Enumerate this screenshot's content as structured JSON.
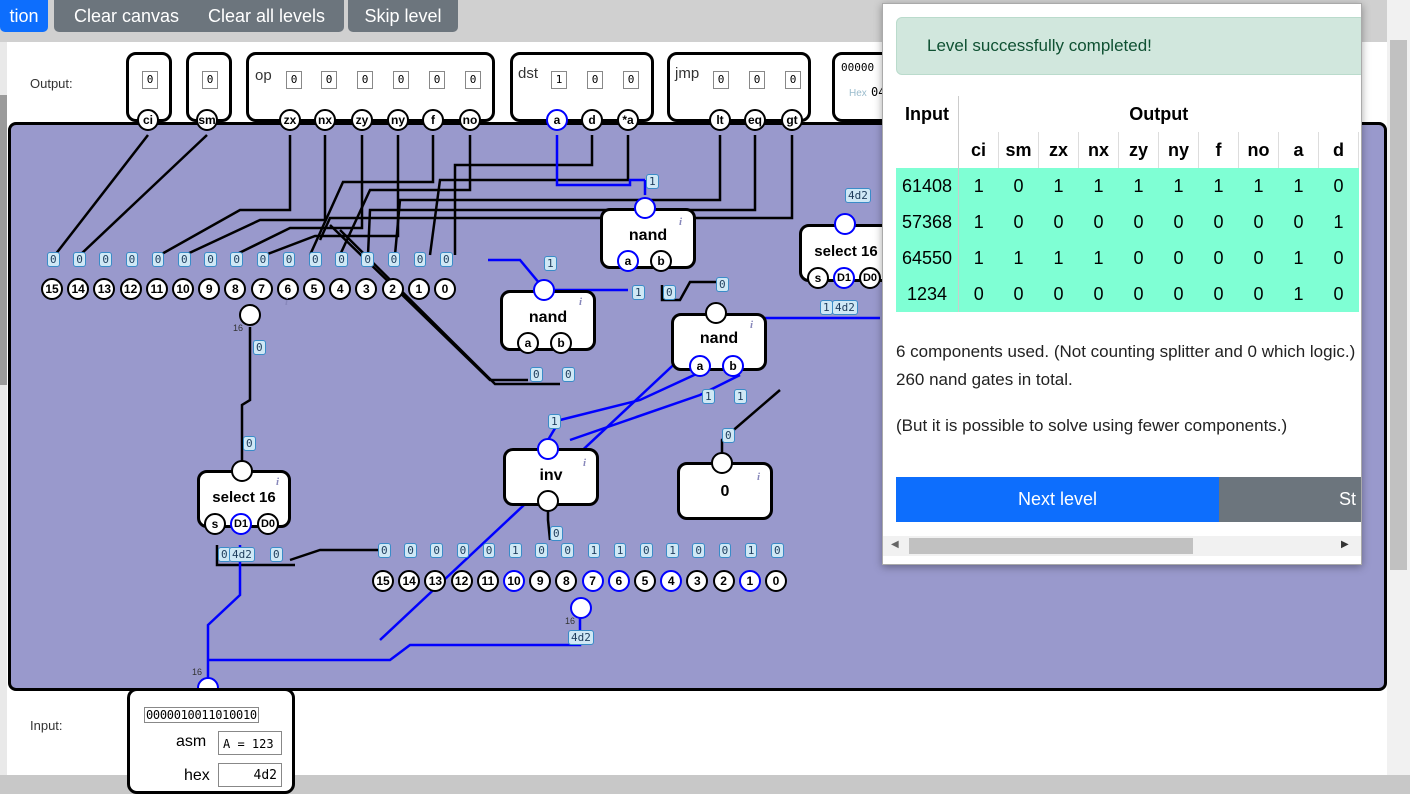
{
  "toolbar": {
    "partial_button": "tion",
    "clear_canvas": "Clear canvas",
    "clear_all_levels": "Clear all levels",
    "skip_level": "Skip level"
  },
  "output_panel": {
    "label": "Output:",
    "ci": {
      "name": "ci",
      "value": "0"
    },
    "sm": {
      "name": "sm",
      "value": "0"
    },
    "op": {
      "label": "op",
      "values": [
        "0",
        "0",
        "0",
        "0",
        "0",
        "0"
      ],
      "pins": [
        "zx",
        "nx",
        "zy",
        "ny",
        "f",
        "no"
      ]
    },
    "dst": {
      "label": "dst",
      "values": [
        "1",
        "0",
        "0"
      ],
      "pins": [
        "a",
        "d",
        "*a"
      ]
    },
    "jmp": {
      "label": "jmp",
      "values": [
        "0",
        "0",
        "0"
      ],
      "pins": [
        "lt",
        "eq",
        "gt"
      ]
    },
    "extra": {
      "binary": "00000",
      "hex_label": "Hex",
      "hex_value": "04"
    }
  },
  "input_panel": {
    "label": "Input:",
    "binary": "0000010011010010",
    "asm_label": "asm",
    "asm_value": "A = 123",
    "hex_label": "hex",
    "hex_value": "4d2"
  },
  "board": {
    "left_splitter_bits": [
      "15",
      "14",
      "13",
      "12",
      "11",
      "10",
      "9",
      "8",
      "7",
      "6",
      "5",
      "4",
      "3",
      "2",
      "1",
      "0"
    ],
    "left_splitter_values": [
      "0",
      "0",
      "0",
      "0",
      "0",
      "0",
      "0",
      "0",
      "0",
      "0",
      "0",
      "0",
      "0",
      "0",
      "0",
      "0"
    ],
    "bottom_splitter_bits": [
      "15",
      "14",
      "13",
      "12",
      "11",
      "10",
      "9",
      "8",
      "7",
      "6",
      "5",
      "4",
      "3",
      "2",
      "1",
      "0"
    ],
    "bottom_splitter_values": [
      "0",
      "0",
      "0",
      "0",
      "0",
      "1",
      "0",
      "0",
      "1",
      "1",
      "0",
      "1",
      "0",
      "0",
      "1",
      "0"
    ],
    "nand_label": "nand",
    "select_label": "select 16",
    "inv_label": "inv",
    "zero_label": "0",
    "pin_a": "a",
    "pin_b": "b",
    "pin_s": "s",
    "pin_d1": "D1",
    "pin_d0": "D0",
    "value_0": "0",
    "value_1": "1",
    "value_hex": "4d2",
    "bus_width": "16",
    "info_icon": "i"
  },
  "popup": {
    "success": "Level successfully completed!",
    "input_header": "Input",
    "output_header": "Output",
    "columns": [
      "ci",
      "sm",
      "zx",
      "nx",
      "zy",
      "ny",
      "f",
      "no",
      "a",
      "d"
    ],
    "rows": [
      {
        "input": "61408",
        "out": [
          "1",
          "0",
          "1",
          "1",
          "1",
          "1",
          "1",
          "1",
          "1",
          "0"
        ]
      },
      {
        "input": "57368",
        "out": [
          "1",
          "0",
          "0",
          "0",
          "0",
          "0",
          "0",
          "0",
          "0",
          "1"
        ]
      },
      {
        "input": "64550",
        "out": [
          "1",
          "1",
          "1",
          "1",
          "0",
          "0",
          "0",
          "0",
          "1",
          "0"
        ]
      },
      {
        "input": "1234",
        "out": [
          "0",
          "0",
          "0",
          "0",
          "0",
          "0",
          "0",
          "0",
          "1",
          "0"
        ]
      }
    ],
    "stats": "6 components used. (Not counting splitter and 0 which logic.) 260 nand gates in total.",
    "hint": "(But it is possible to solve using fewer components.)",
    "next_level": "Next level",
    "start": "St"
  }
}
